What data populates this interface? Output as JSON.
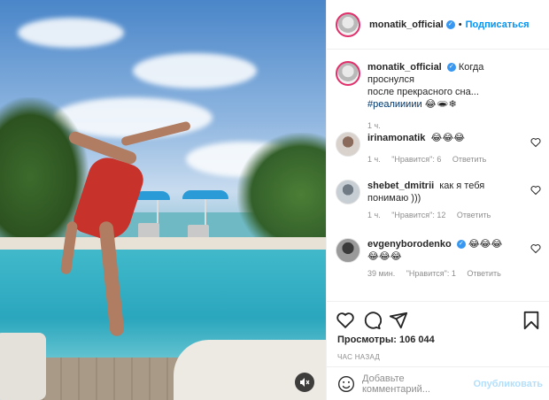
{
  "post": {
    "author": "monatik_official",
    "follow_label": "Подписаться",
    "dot": "•"
  },
  "caption": {
    "author": "monatik_official",
    "text_line1": "Когда проснулся",
    "text_line2": "после прекрасного сна...",
    "text_line3": "#реалиииии",
    "emojis": "😂🕳❄",
    "time": "1 ч."
  },
  "comments": [
    {
      "author": "irinamonatik",
      "text": "😂😂😂",
      "time": "1 ч.",
      "likes": "\"Нравится\": 6",
      "reply": "Ответить"
    },
    {
      "author": "shebet_dmitrii",
      "text": "как я тебя понимаю )))",
      "time": "1 ч.",
      "likes": "\"Нравится\": 12",
      "reply": "Ответить"
    },
    {
      "author": "evgenyborodenko",
      "text_line1": "😂😂😂",
      "text_line2": "😂😂😂",
      "time": "39 мин.",
      "likes": "\"Нравится\": 1",
      "reply": "Ответить"
    }
  ],
  "stats": {
    "views": "Просмотры: 106 044",
    "posted": "ЧАС НАЗАД"
  },
  "composer": {
    "placeholder": "Добавьте комментарий...",
    "publish_label": "Опубликовать"
  },
  "colors": {
    "accent": "#0095f6",
    "publish_disabled": "#b2dffc",
    "verified": "#3897f0",
    "meta_gray": "#8e8e8e"
  },
  "icons": [
    "verified-badge-icon",
    "heart-icon",
    "comment-icon",
    "share-icon",
    "bookmark-icon",
    "emoji-icon",
    "mute-icon"
  ]
}
